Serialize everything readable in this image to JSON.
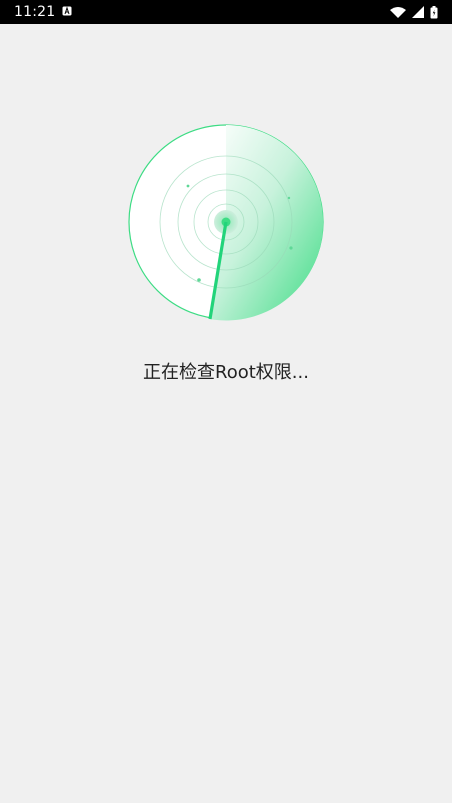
{
  "status_bar": {
    "time": "11:21",
    "icons": [
      "notification-a-icon",
      "wifi-icon",
      "cell-signal-icon",
      "battery-icon"
    ]
  },
  "scan": {
    "message": "正在检查Root权限..."
  },
  "colors": {
    "background": "#f0f0f0",
    "accent": "#3ddc84",
    "accent_dark": "#2ecf7a",
    "status_bar": "#000000",
    "text": "#222222"
  }
}
